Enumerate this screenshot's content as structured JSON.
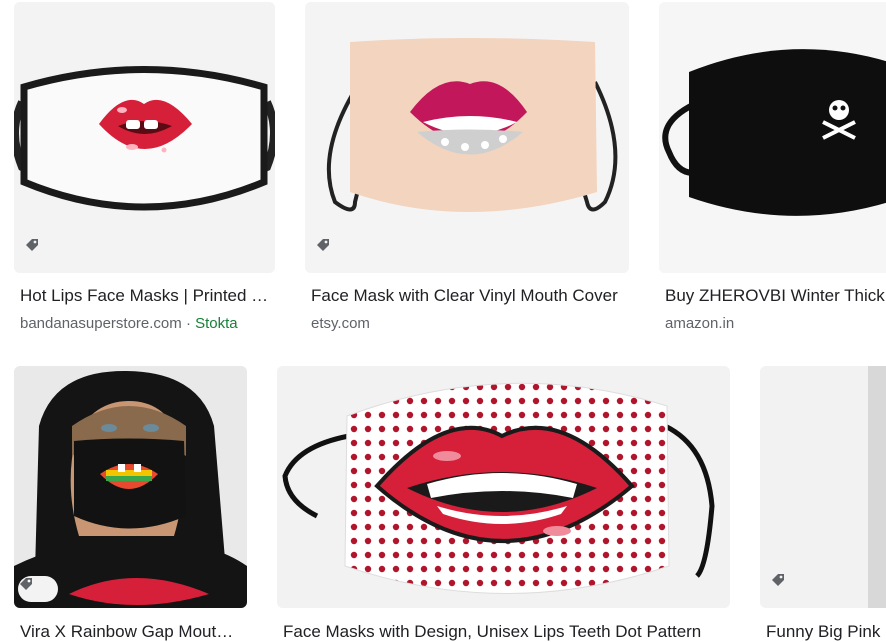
{
  "results": [
    {
      "title": "Hot Lips Face Masks | Printed Face Masks",
      "source": "bandanasuperstore.com",
      "separator": " · ",
      "stock": "Stokta",
      "tag_icon": "price-tag-icon"
    },
    {
      "title": "Face Mask with Clear Vinyl Mouth Cover",
      "source": "etsy.com",
      "tag_icon": "price-tag-icon"
    },
    {
      "title": "Buy ZHEROVBI Winter Thick",
      "source": "amazon.in"
    },
    {
      "title": "Vira X Rainbow Gap Mouth Mask",
      "source": "",
      "tag_icon": "price-tag-icon"
    },
    {
      "title": "Face Masks with Design, Unisex Lips Teeth Dot Pattern",
      "source": ""
    },
    {
      "title": "Funny Big Pink",
      "source": "",
      "tag_icon": "price-tag-icon"
    }
  ],
  "colors": {
    "title": "#202124",
    "source": "#5f6368",
    "stock": "#188038",
    "lips": "#d6203a"
  }
}
